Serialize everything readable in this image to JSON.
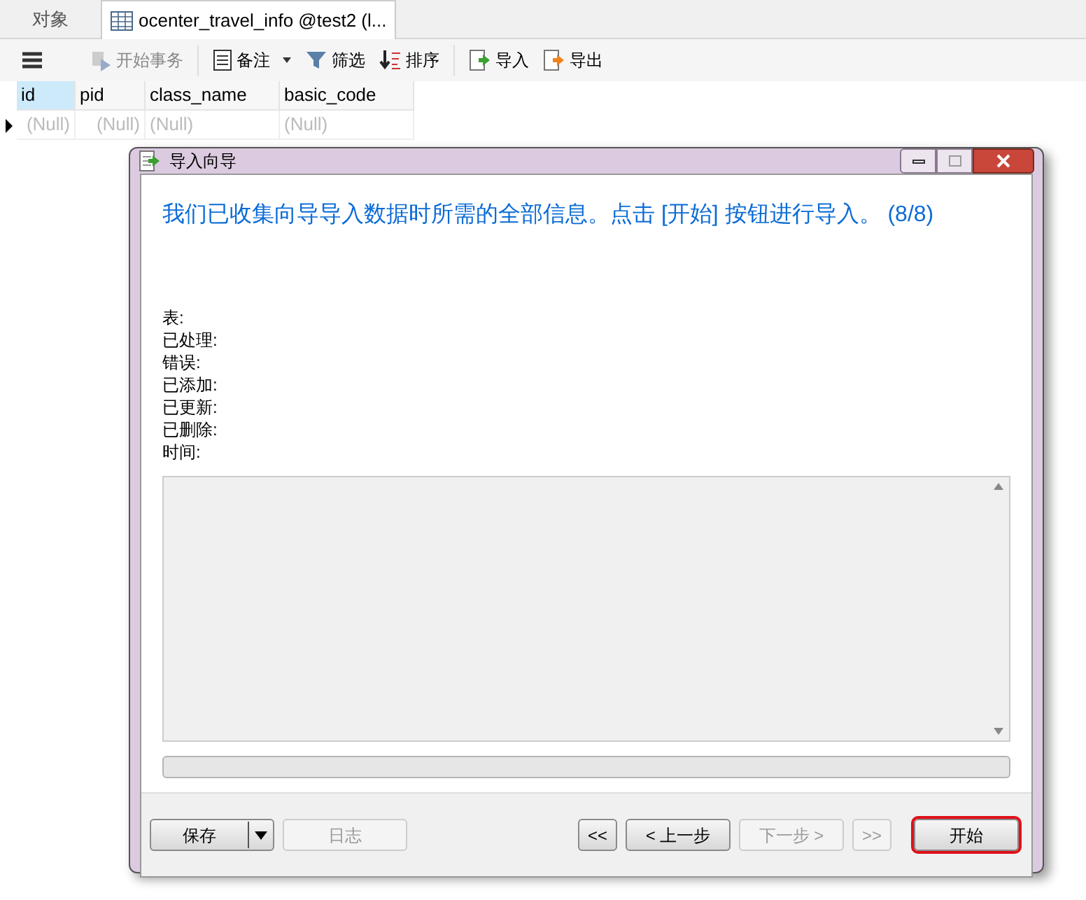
{
  "tabs": [
    {
      "label": "对象",
      "selected": false
    },
    {
      "label": "ocenter_travel_info @test2 (l...",
      "selected": true
    }
  ],
  "toolbar": [
    {
      "kind": "menu"
    },
    {
      "kind": "button",
      "label": "开始事务",
      "disabled": true
    },
    {
      "kind": "separator"
    },
    {
      "kind": "dropdown",
      "label": "备注",
      "disabled": false
    },
    {
      "kind": "button",
      "label": "筛选",
      "disabled": false
    },
    {
      "kind": "button",
      "label": "排序",
      "disabled": false
    },
    {
      "kind": "separator"
    },
    {
      "kind": "button",
      "label": "导入",
      "disabled": false
    },
    {
      "kind": "button",
      "label": "导出",
      "disabled": false
    }
  ],
  "grid": {
    "columns": [
      {
        "label": "id",
        "selected": true
      },
      {
        "label": "pid",
        "selected": false
      },
      {
        "label": "class_name",
        "selected": false
      },
      {
        "label": "basic_code",
        "selected": false
      }
    ],
    "rows": [
      {
        "current": true,
        "cells": [
          "(Null)",
          "(Null)",
          "(Null)",
          "(Null)"
        ]
      }
    ]
  },
  "dialog": {
    "title": "导入向导",
    "heading": "我们已收集向导导入数据时所需的全部信息。点击 [开始] 按钮进行导入。 (8/8)",
    "fields": [
      "表:",
      "已处理:",
      "错误:",
      "已添加:",
      "已更新:",
      "已删除:",
      "时间:"
    ],
    "progress": {
      "level": 0
    },
    "buttons": [
      {
        "kind": "split",
        "label": "保存",
        "disabled": false,
        "default": false
      },
      {
        "kind": "button",
        "label": "日志",
        "disabled": true,
        "default": false
      },
      {
        "kind": "spacer"
      },
      {
        "kind": "small",
        "label": "<<",
        "disabled": false,
        "default": false
      },
      {
        "kind": "button",
        "label": "< 上一步",
        "disabled": false,
        "default": false
      },
      {
        "kind": "button",
        "label": "下一步 >",
        "disabled": true,
        "default": false
      },
      {
        "kind": "small",
        "label": ">>",
        "disabled": true,
        "default": false
      },
      {
        "kind": "button",
        "label": "开始",
        "disabled": false,
        "default": true
      }
    ]
  }
}
